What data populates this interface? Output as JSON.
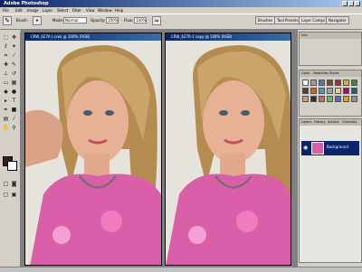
{
  "app": {
    "title": "Adobe Photoshop"
  },
  "menus": [
    "File",
    "Edit",
    "Image",
    "Layer",
    "Select",
    "Filter",
    "View",
    "Window",
    "Help"
  ],
  "options_bar": {
    "brush_label": "Brush:",
    "mode_label": "Mode:",
    "mode_value": "Normal",
    "opacity_label": "Opacity:",
    "opacity_value": "100%",
    "flow_label": "Flow:",
    "flow_value": "100%",
    "tabs": [
      "Brushes",
      "Tool Presets",
      "Layer Comps",
      "Navigator"
    ]
  },
  "documents": [
    {
      "title": "CRW_6270 (.crw) @ 100% (RGB)"
    },
    {
      "title": "CRW_6270-1 copy @ 100% (RGB)"
    }
  ],
  "panels": {
    "info": {
      "tabs": [
        "Info"
      ]
    },
    "color": {
      "tabs": [
        "Color",
        "Swatches",
        "Styles"
      ]
    },
    "layers": {
      "tabs": [
        "Layers",
        "History",
        "Actions",
        "Channels"
      ],
      "layer_name": "Background"
    }
  },
  "colors": {
    "foreground": "#3a1f1a",
    "background": "#ffffff",
    "title_active": "#0a246a"
  },
  "icons": [
    "move-icon",
    "marquee-icon",
    "lasso-icon",
    "crop-icon",
    "brush-icon",
    "eraser-icon",
    "text-icon",
    "hand-icon",
    "zoom-icon"
  ]
}
